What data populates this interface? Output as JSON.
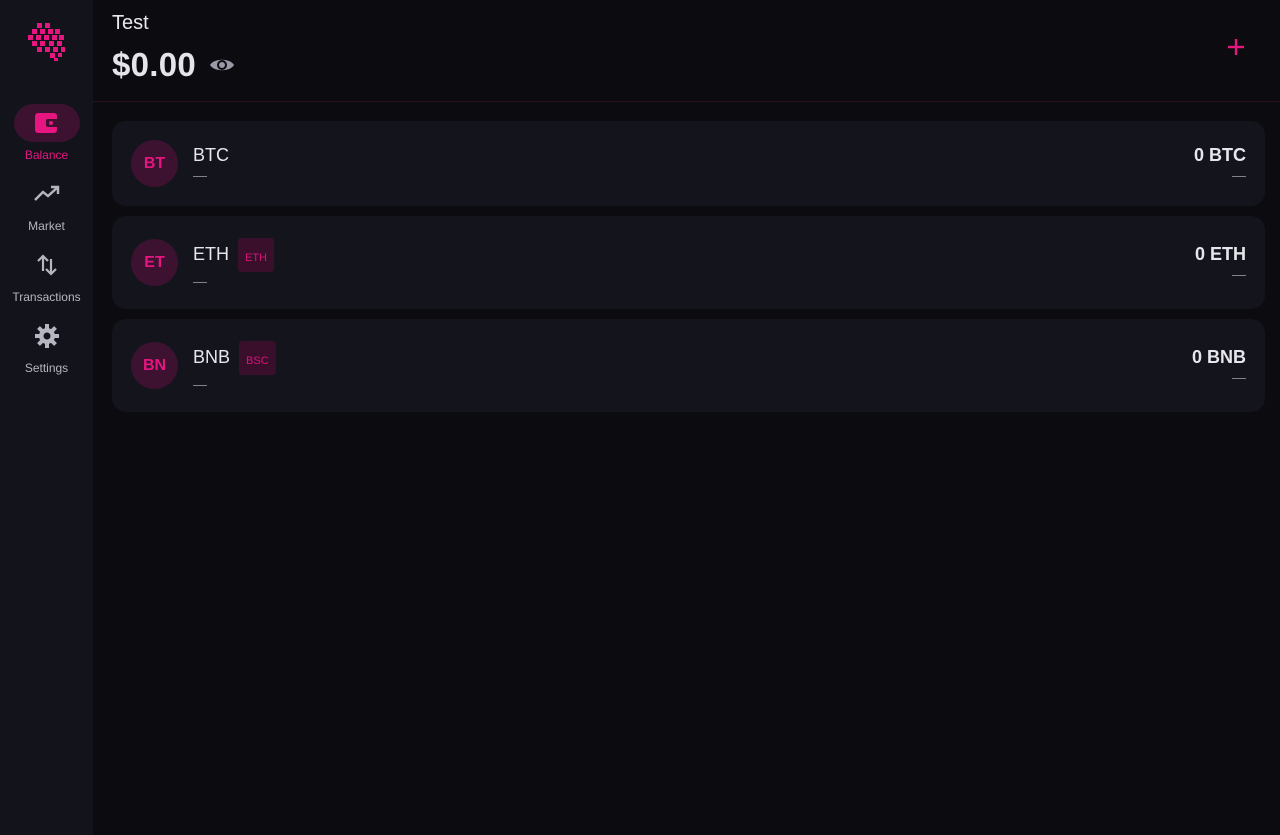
{
  "sidebar": {
    "items": [
      {
        "label": "Balance",
        "icon": "wallet-icon",
        "active": true
      },
      {
        "label": "Market",
        "icon": "trending-up-icon",
        "active": false
      },
      {
        "label": "Transactions",
        "icon": "swap-vertical-icon",
        "active": false
      },
      {
        "label": "Settings",
        "icon": "gear-icon",
        "active": false
      }
    ]
  },
  "header": {
    "wallet_name": "Test",
    "balance": "$0.00"
  },
  "assets": [
    {
      "initials": "BT",
      "name": "BTC",
      "chain": "",
      "sub": "—",
      "amount": "0 BTC",
      "fiat": "—"
    },
    {
      "initials": "ET",
      "name": "ETH",
      "chain": "ETH",
      "sub": "—",
      "amount": "0 ETH",
      "fiat": "—"
    },
    {
      "initials": "BN",
      "name": "BNB",
      "chain": "BSC",
      "sub": "—",
      "amount": "0 BNB",
      "fiat": "—"
    }
  ],
  "colors": {
    "accent": "#e6157f",
    "accent_bg": "#3c1230",
    "sidebar_bg": "#13131c",
    "main_bg": "#0b0b10",
    "card_bg": "#14141d"
  }
}
